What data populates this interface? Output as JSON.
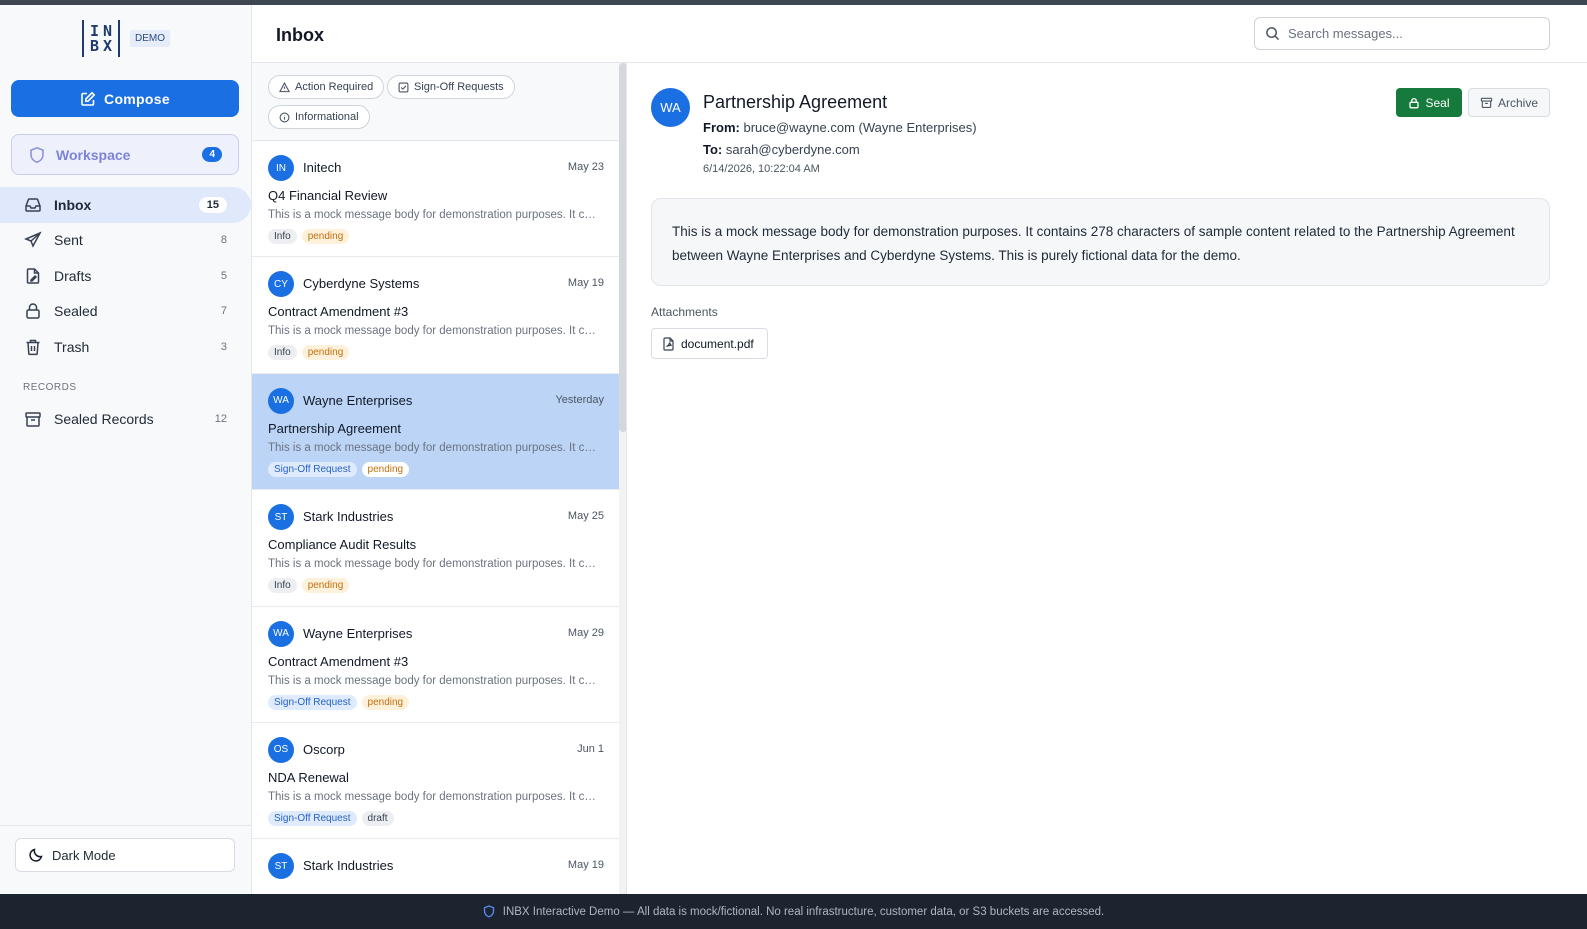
{
  "logo": {
    "mark_top": "IN",
    "mark_bottom": "BX",
    "badge": "DEMO"
  },
  "sidebar": {
    "compose_label": "Compose",
    "workspace": {
      "label": "Workspace",
      "count": "4"
    },
    "items": [
      {
        "label": "Inbox",
        "count": "15",
        "icon": "inbox-icon"
      },
      {
        "label": "Sent",
        "count": "8",
        "icon": "send-icon"
      },
      {
        "label": "Drafts",
        "count": "5",
        "icon": "draft-icon"
      },
      {
        "label": "Sealed",
        "count": "7",
        "icon": "lock-icon"
      },
      {
        "label": "Trash",
        "count": "3",
        "icon": "trash-icon"
      }
    ],
    "records_heading": "RECORDS",
    "records_item": {
      "label": "Sealed Records",
      "count": "12",
      "icon": "archive-box-icon"
    },
    "dark_mode_label": "Dark Mode"
  },
  "header": {
    "title": "Inbox",
    "search_placeholder": "Search messages..."
  },
  "filters": {
    "action_required": "Action Required",
    "signoff_requests": "Sign-Off Requests",
    "informational": "Informational"
  },
  "messages": [
    {
      "initials": "IN",
      "sender": "Initech",
      "date": "May 23",
      "subject": "Q4 Financial Review",
      "preview": "This is a mock message body for demonstration purposes. It contains",
      "tag": "Info",
      "status": "pending"
    },
    {
      "initials": "CY",
      "sender": "Cyberdyne Systems",
      "date": "May 19",
      "subject": "Contract Amendment #3",
      "preview": "This is a mock message body for demonstration purposes. It contains",
      "tag": "Info",
      "status": "pending"
    },
    {
      "initials": "WA",
      "sender": "Wayne Enterprises",
      "date": "Yesterday",
      "subject": "Partnership Agreement",
      "preview": "This is a mock message body for demonstration purposes. It contains",
      "tag": "Sign-Off Request",
      "status": "pending"
    },
    {
      "initials": "ST",
      "sender": "Stark Industries",
      "date": "May 25",
      "subject": "Compliance Audit Results",
      "preview": "This is a mock message body for demonstration purposes. It contains",
      "tag": "Info",
      "status": "pending"
    },
    {
      "initials": "WA",
      "sender": "Wayne Enterprises",
      "date": "May 29",
      "subject": "Contract Amendment #3",
      "preview": "This is a mock message body for demonstration purposes. It contains",
      "tag": "Sign-Off Request",
      "status": "pending"
    },
    {
      "initials": "OS",
      "sender": "Oscorp",
      "date": "Jun 1",
      "subject": "NDA Renewal",
      "preview": "This is a mock message body for demonstration purposes. It contains",
      "tag": "Sign-Off Request",
      "status": "draft"
    },
    {
      "initials": "ST",
      "sender": "Stark Industries",
      "date": "May 19",
      "subject": "",
      "preview": "",
      "tag": "",
      "status": ""
    }
  ],
  "detail": {
    "initials": "WA",
    "subject": "Partnership Agreement",
    "from_label": "From:",
    "from_value": "bruce@wayne.com (Wayne Enterprises)",
    "to_label": "To:",
    "to_value": "sarah@cyberdyne.com",
    "datetime": "6/14/2026, 10:22:04 AM",
    "seal_label": "Seal",
    "archive_label": "Archive",
    "body": "This is a mock message body for demonstration purposes. It contains 278 characters of sample content related to the Partnership Agreement between Wayne Enterprises and Cyberdyne Systems. This is purely fictional data for the demo.",
    "attachments_label": "Attachments",
    "attachment_name": "document.pdf"
  },
  "footer": {
    "text": "INBX Interactive Demo — All data is mock/fictional. No real infrastructure, customer data, or S3 buckets are accessed."
  },
  "colors": {
    "accent": "#1a6fe3",
    "seal_green": "#157a3b",
    "selected_row": "#bcd5f6",
    "footer_bg": "#1c2430"
  }
}
